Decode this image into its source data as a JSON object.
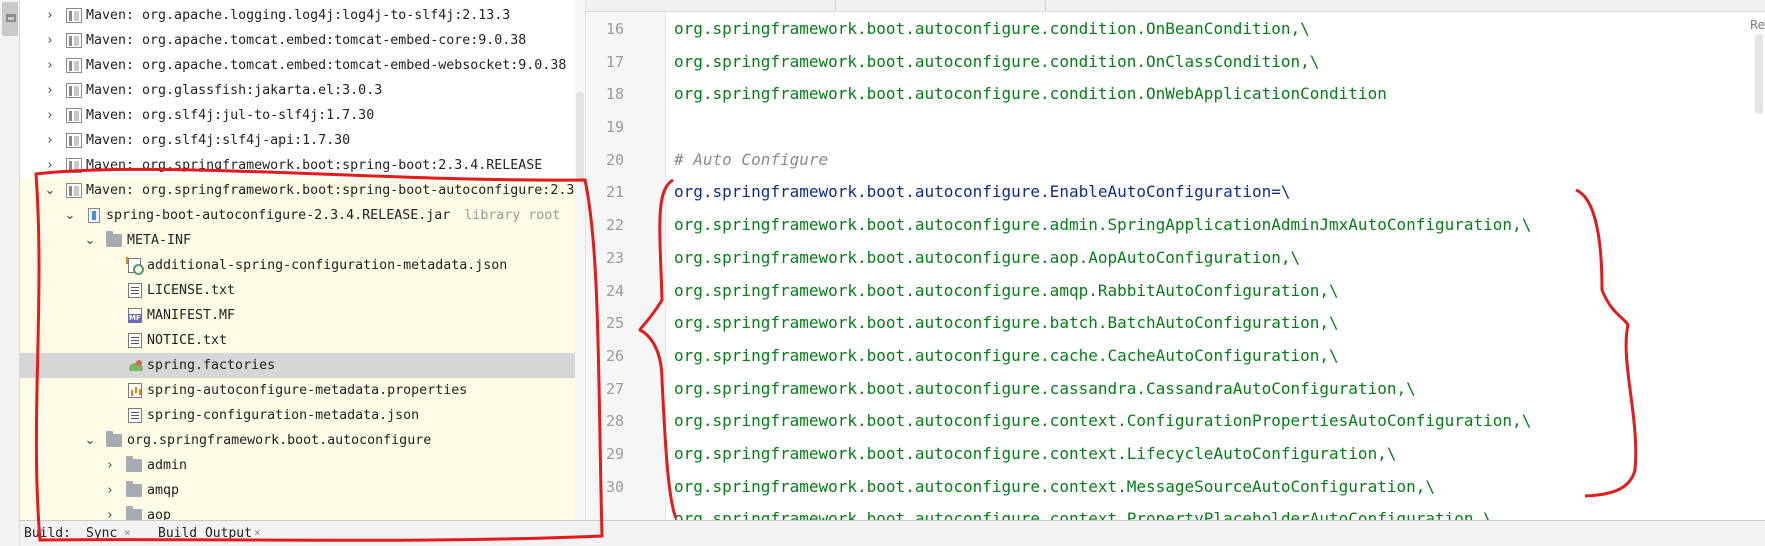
{
  "tree": {
    "rows": [
      {
        "label": "Maven: org.apache.logging.log4j:log4j-to-slf4j:2.13.3",
        "suffix": ""
      },
      {
        "label": "Maven: org.apache.tomcat.embed:tomcat-embed-core:9.0.38",
        "suffix": ""
      },
      {
        "label": "Maven: org.apache.tomcat.embed:tomcat-embed-websocket:9.0.38",
        "suffix": ""
      },
      {
        "label": "Maven: org.glassfish:jakarta.el:3.0.3",
        "suffix": ""
      },
      {
        "label": "Maven: org.slf4j:jul-to-slf4j:1.7.30",
        "suffix": ""
      },
      {
        "label": "Maven: org.slf4j:slf4j-api:1.7.30",
        "suffix": ""
      },
      {
        "label": "Maven: org.springframework.boot:spring-boot:2.3.4.RELEASE",
        "suffix": ""
      },
      {
        "label": "Maven: org.springframework.boot:spring-boot-autoconfigure:2.3",
        "suffix": ""
      },
      {
        "label": "spring-boot-autoconfigure-2.3.4.RELEASE.jar",
        "suffix": "library root"
      },
      {
        "label": "META-INF",
        "suffix": ""
      },
      {
        "label": "additional-spring-configuration-metadata.json",
        "suffix": ""
      },
      {
        "label": "LICENSE.txt",
        "suffix": ""
      },
      {
        "label": "MANIFEST.MF",
        "suffix": ""
      },
      {
        "label": "NOTICE.txt",
        "suffix": ""
      },
      {
        "label": "spring.factories",
        "suffix": ""
      },
      {
        "label": "spring-autoconfigure-metadata.properties",
        "suffix": ""
      },
      {
        "label": "spring-configuration-metadata.json",
        "suffix": ""
      },
      {
        "label": "org.springframework.boot.autoconfigure",
        "suffix": ""
      },
      {
        "label": "admin",
        "suffix": ""
      },
      {
        "label": "amqp",
        "suffix": ""
      },
      {
        "label": "aop",
        "suffix": ""
      }
    ]
  },
  "editor": {
    "hint": "Re",
    "lines": [
      {
        "num": "16",
        "text": "org.springframework.boot.autoconfigure.condition.OnBeanCondition,\\"
      },
      {
        "num": "17",
        "text": "org.springframework.boot.autoconfigure.condition.OnClassCondition,\\"
      },
      {
        "num": "18",
        "text": "org.springframework.boot.autoconfigure.condition.OnWebApplicationCondition"
      },
      {
        "num": "19",
        "text": ""
      },
      {
        "num": "20",
        "text": "# Auto Configure"
      },
      {
        "num": "21",
        "text": "org.springframework.boot.autoconfigure.EnableAutoConfiguration=\\"
      },
      {
        "num": "22",
        "text": "org.springframework.boot.autoconfigure.admin.SpringApplicationAdminJmxAutoConfiguration,\\"
      },
      {
        "num": "23",
        "text": "org.springframework.boot.autoconfigure.aop.AopAutoConfiguration,\\"
      },
      {
        "num": "24",
        "text": "org.springframework.boot.autoconfigure.amqp.RabbitAutoConfiguration,\\"
      },
      {
        "num": "25",
        "text": "org.springframework.boot.autoconfigure.batch.BatchAutoConfiguration,\\"
      },
      {
        "num": "26",
        "text": "org.springframework.boot.autoconfigure.cache.CacheAutoConfiguration,\\"
      },
      {
        "num": "27",
        "text": "org.springframework.boot.autoconfigure.cassandra.CassandraAutoConfiguration,\\"
      },
      {
        "num": "28",
        "text": "org.springframework.boot.autoconfigure.context.ConfigurationPropertiesAutoConfiguration,\\"
      },
      {
        "num": "29",
        "text": "org.springframework.boot.autoconfigure.context.LifecycleAutoConfiguration,\\"
      },
      {
        "num": "30",
        "text": "org.springframework.boot.autoconfigure.context.MessageSourceAutoConfiguration,\\"
      },
      {
        "num": "",
        "text": "org.springframework.boot.autoconfigure.context.PropertyPlaceholderAutoConfiguration,\\"
      }
    ]
  },
  "build_bar": {
    "build_label": "Build:",
    "sync_tab": "Sync",
    "output_tab": "Build Output",
    "close_glyph": "×"
  },
  "colors": {
    "annotation": "#e21b1b",
    "highlight_row": "#fffbe6",
    "selected_row": "#d6d6d6",
    "code_green": "#067d17",
    "code_key": "#0e2d8b"
  }
}
